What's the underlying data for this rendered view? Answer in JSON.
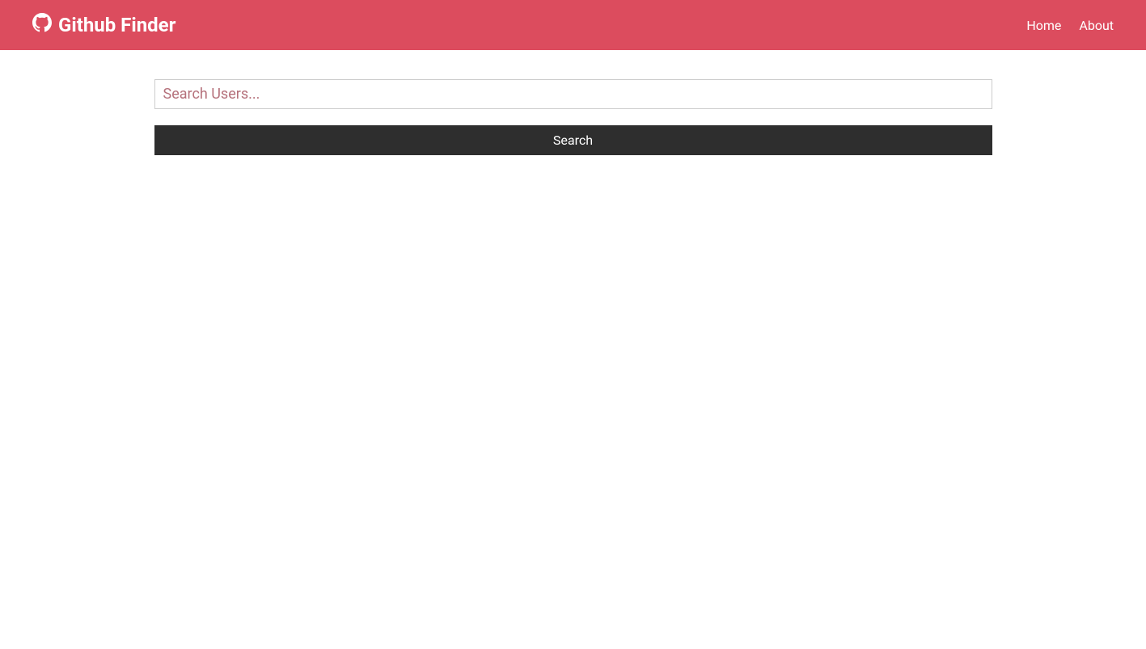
{
  "navbar": {
    "brand": "Github Finder",
    "links": {
      "home": "Home",
      "about": "About"
    }
  },
  "search": {
    "placeholder": "Search Users...",
    "value": "",
    "button_label": "Search"
  }
}
